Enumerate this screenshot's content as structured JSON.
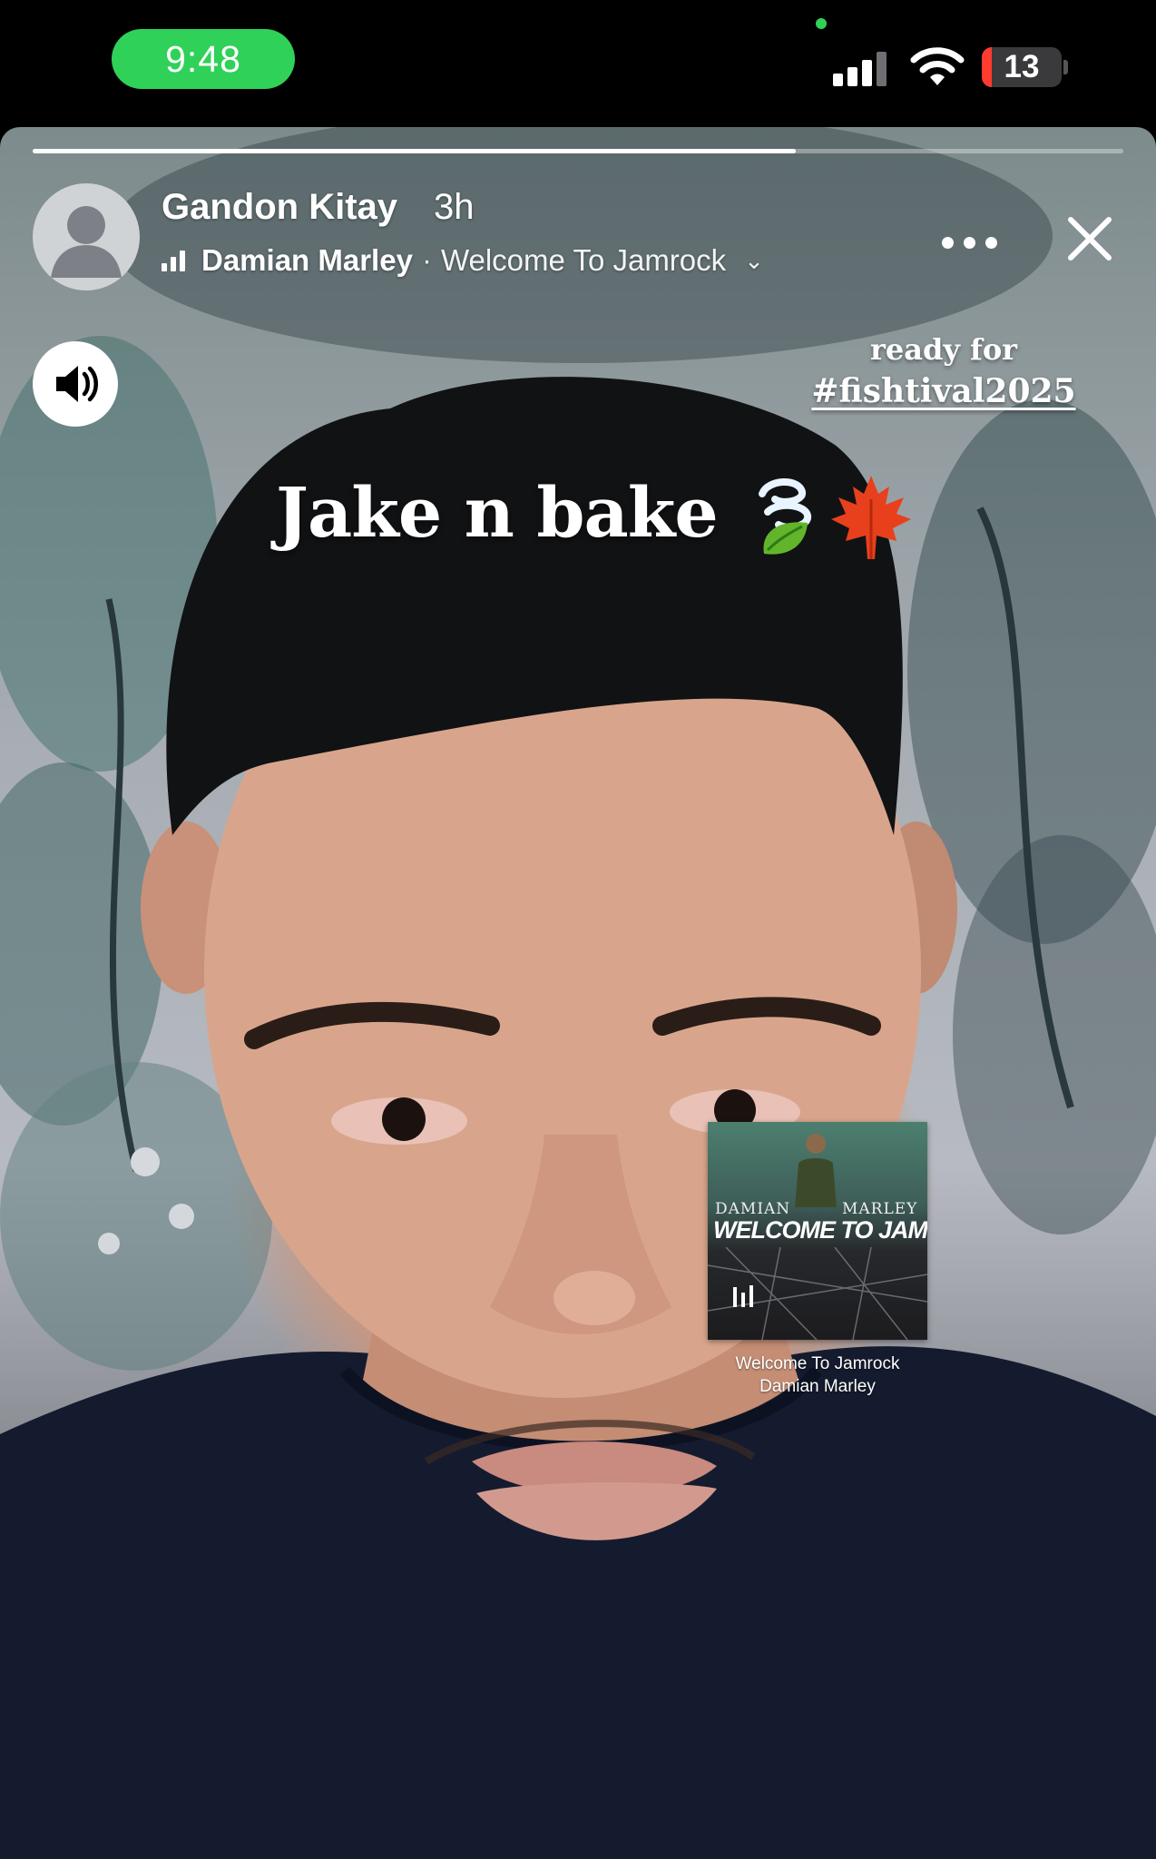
{
  "status_bar": {
    "time": "9:48",
    "battery_level": "13",
    "accent_color": "#30d158",
    "battery_color": "#ff3b30"
  },
  "story": {
    "progress": 0.7,
    "username": "Gandon Kitay",
    "time_ago": "3h",
    "music": {
      "artist": "Damian Marley",
      "separator": "·",
      "song": "Welcome To Jamrock"
    },
    "icons": [
      "more-icon",
      "close-icon",
      "speaker-icon",
      "equalizer-icon",
      "chevron-down-icon"
    ]
  },
  "overlays": {
    "caption_small_line1": "ready for",
    "caption_small_line2": "#fishtival2025",
    "caption_big": "Jake n bake",
    "emojis": [
      "🍃",
      "🍁"
    ]
  },
  "music_sticker": {
    "cover_line1_left": "DAMIAN",
    "cover_line1_right": "MARLEY",
    "cover_line2": "WELCOME TO JAM",
    "title": "Welcome To Jamrock",
    "artist": "Damian Marley"
  }
}
